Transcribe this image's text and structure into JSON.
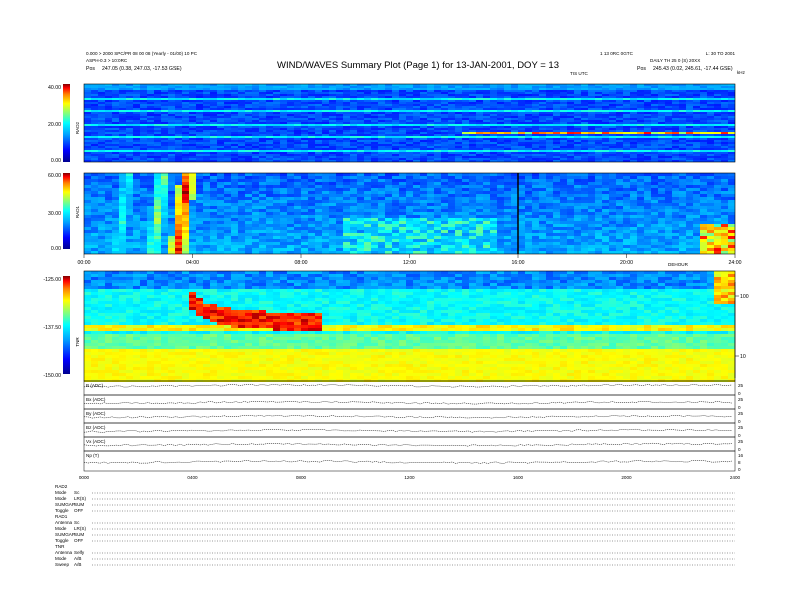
{
  "header": {
    "title": "WIND/WAVES Summary Plot (Page 1) for 13-JAN-2001, DOY = 13",
    "left_line1": "0.000 > 2000 SPC/PR 08 00 08 (Yearly - 01/00) 10 PC",
    "left_line2": "ASPH-0.3 > 10:0RC",
    "left_line3_label": "Pos",
    "left_line3": "247.05 (0.38, 247.03, -17.53 GSE)",
    "right_line1": "1 13 0RC 0GTC",
    "right_line1b": "L: 30 TO 2001",
    "right_line2": "DAILY TH 25 0 (S) 20XX",
    "right_line3_label": "Pos",
    "right_line3": "245.43 (0.02, 245.61, -17.44 GSE)",
    "sub_right": "TIS UTC",
    "corner": "kHz"
  },
  "icons": {
    "left_colorbar": "colorbar-icon",
    "right_scale": "khz-scale-icon"
  },
  "chart_data": [
    {
      "type": "heatmap",
      "panel": "RAD2",
      "ylabel": "RAD2",
      "ylim": [
        0,
        40
      ],
      "ytick_labels": [
        "40.00",
        "20.00",
        "0.00"
      ],
      "x": "UT hours 00:00-24:00",
      "colorscale": [
        "#00008f",
        "#0000ff",
        "#00a0ff",
        "#00ffff",
        "#7fff7f",
        "#ffff00",
        "#ff7f00",
        "#ff0000",
        "#800000"
      ]
    },
    {
      "type": "heatmap",
      "panel": "RAD1",
      "ylabel": "RAD1",
      "ylim": [
        0,
        60
      ],
      "ytick_labels": [
        "60.00",
        "30.00",
        "0.00"
      ],
      "xtick_labels": [
        "00:00",
        "04:00",
        "08:00",
        "12:00",
        "16:00",
        "20:00",
        "24:00"
      ],
      "xlabel_right": "DEHOUR",
      "features": [
        {
          "name": "type III burst",
          "x_hour": 1.1,
          "value": 0.5
        },
        {
          "name": "type III burst",
          "x_hour": 2.4,
          "value": 0.6
        },
        {
          "name": "type III burst",
          "x_hour": 3.3,
          "value": 0.9
        },
        {
          "name": "data gap",
          "x_hour": 16.0,
          "value": 0
        }
      ]
    },
    {
      "type": "heatmap",
      "panel": "TNR",
      "ylabel": "TNR",
      "ylim": [
        -150,
        -125
      ],
      "ytick_labels": [
        "-125.00",
        "-137.50",
        "-150.00"
      ],
      "right_axis_labels": [
        "100",
        "10"
      ],
      "features": [
        {
          "name": "intense emission",
          "x_hour": 3.7,
          "value": 1.0
        },
        {
          "name": "plasma line",
          "x_hour": 12.0,
          "value": 0.7
        }
      ]
    },
    {
      "type": "line",
      "panels": [
        {
          "label": "B (ADC)",
          "ticks": [
            "25",
            "0"
          ]
        },
        {
          "label": "Bx (ADC)",
          "ticks": [
            "25",
            "0"
          ]
        },
        {
          "label": "By (ADC)",
          "ticks": [
            "25",
            "0"
          ]
        },
        {
          "label": "Bz (ADC)",
          "ticks": [
            "25",
            "0"
          ]
        },
        {
          "label": "Vx (ADC)",
          "ticks": [
            "25",
            "0"
          ]
        },
        {
          "label": "Np (T)",
          "ticks": [
            "16",
            "8",
            "0"
          ]
        }
      ],
      "xtick_labels": [
        "0000",
        "0400",
        "0800",
        "1200",
        "1600",
        "2000",
        "2400"
      ]
    }
  ],
  "footer": {
    "sections": [
      {
        "name": "RAD2",
        "rows": [
          {
            "k": "Mode",
            "v": "Sc"
          },
          {
            "k": "Mode",
            "v": "LR(S)"
          },
          {
            "k": "SUMGAP",
            "v": "SUM"
          },
          {
            "k": "Toggle",
            "v": "OFF"
          }
        ]
      },
      {
        "name": "RAD1",
        "rows": [
          {
            "k": "Antenna",
            "v": "Sc"
          },
          {
            "k": "Mode",
            "v": "LR(S)"
          },
          {
            "k": "SUMGAP",
            "v": "SUM"
          },
          {
            "k": "Toggle",
            "v": "OFF"
          }
        ]
      },
      {
        "name": "TNR",
        "rows": [
          {
            "k": "Antenna",
            "v": "Selfy"
          },
          {
            "k": "Mode",
            "v": "A/B"
          },
          {
            "k": "Sweep",
            "v": "A/B"
          }
        ]
      }
    ]
  }
}
